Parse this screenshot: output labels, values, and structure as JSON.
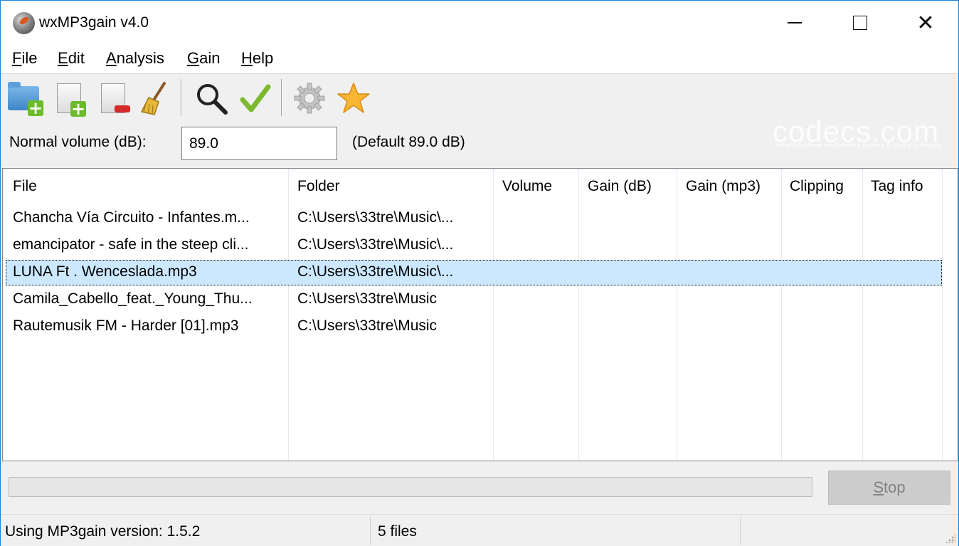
{
  "window": {
    "title": "wxMP3gain v4.0"
  },
  "menu": [
    {
      "label": "File",
      "mnemonic": "F",
      "rest": "ile"
    },
    {
      "label": "Edit",
      "mnemonic": "E",
      "rest": "dit"
    },
    {
      "label": "Analysis",
      "mnemonic": "A",
      "rest": "nalysis"
    },
    {
      "label": "Gain",
      "mnemonic": "G",
      "rest": "ain"
    },
    {
      "label": "Help",
      "mnemonic": "H",
      "rest": "elp"
    }
  ],
  "toolbar": {
    "icons": [
      "add-folder-icon",
      "add-file-icon",
      "remove-file-icon",
      "clear-list-icon",
      "analyze-icon",
      "apply-gain-icon",
      "settings-icon",
      "favorite-icon"
    ]
  },
  "volume": {
    "label": "Normal volume (dB):",
    "value": "89.0",
    "default_text": "(Default 89.0 dB)"
  },
  "watermark": {
    "text": "codecs.com",
    "subtext": "download free multimedia codecs & utility software"
  },
  "list": {
    "columns": [
      "File",
      "Folder",
      "Volume",
      "Gain (dB)",
      "Gain (mp3)",
      "Clipping",
      "Tag info"
    ],
    "rows": [
      {
        "file": "Chancha Vía Circuito - Infantes.m...",
        "folder": "C:\\Users\\33tre\\Music\\...",
        "selected": false
      },
      {
        "file": "emancipator - safe in the steep cli...",
        "folder": "C:\\Users\\33tre\\Music\\...",
        "selected": false
      },
      {
        "file": "LUNA Ft . Wenceslada.mp3",
        "folder": "C:\\Users\\33tre\\Music\\...",
        "selected": true
      },
      {
        "file": "Camila_Cabello_feat._Young_Thu...",
        "folder": "C:\\Users\\33tre\\Music",
        "selected": false
      },
      {
        "file": "Rautemusik FM - Harder [01].mp3",
        "folder": "C:\\Users\\33tre\\Music",
        "selected": false
      }
    ]
  },
  "progress": {
    "fraction": 0
  },
  "stop_button": {
    "label": "Stop",
    "mnemonic": "S",
    "rest": "top",
    "enabled": false
  },
  "status": {
    "version": "Using MP3gain version: 1.5.2",
    "files": "5 files",
    "extra": ""
  },
  "colors": {
    "selection": "#cce8ff",
    "window_border": "#1883d7",
    "progress_fill": "#06b025"
  }
}
